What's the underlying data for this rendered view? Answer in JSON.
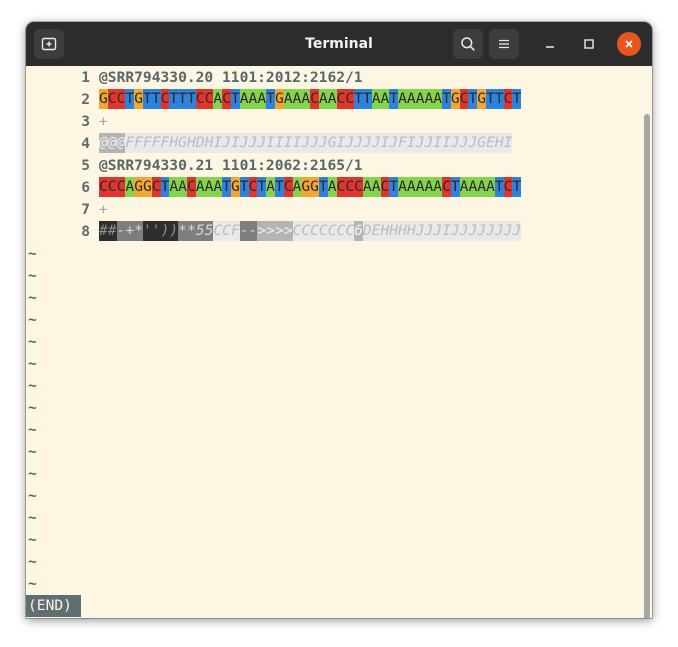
{
  "window": {
    "title": "Terminal"
  },
  "titlebar": {
    "new_tab_icon": "new-tab-icon",
    "search_icon": "search-icon",
    "menu_icon": "hamburger-icon"
  },
  "colors": {
    "A": "#86d34e",
    "C": "#e0342f",
    "G": "#f1a733",
    "T": "#2e83dd",
    "qual_dark": "#2e2e2e",
    "qual_mid": "#7e7e7e",
    "qual_light": "#b4b4b4",
    "qual_pale": "#e9e9e9"
  },
  "lines": [
    {
      "n": "1",
      "type": "header",
      "text": "@SRR794330.20 1101:2012:2162/1"
    },
    {
      "n": "2",
      "type": "seq",
      "text": "GCCTGTTCTTTCCACTAAATGAAACAACCTTAATAAAAATGCTGTTCT"
    },
    {
      "n": "3",
      "type": "plus",
      "text": "+"
    },
    {
      "n": "4",
      "type": "qual",
      "text": "@@@FFFFFHGHDHIJIJJJIIIIJJJGIJJJJIJFIJJIIJJJGEHI"
    },
    {
      "n": "5",
      "type": "header",
      "text": "@SRR794330.21 1101:2062:2165/1"
    },
    {
      "n": "6",
      "type": "seq",
      "text": "CCCAGGCTAACAAATGTCTATCAGGTACCCAACTAAAAACTAAAATCT"
    },
    {
      "n": "7",
      "type": "plus",
      "text": "+"
    },
    {
      "n": "8",
      "type": "qual",
      "text": "##-+*''))**55CCF-->>>>CCCCCCC6DEHHHHJJJIJJJJJJJJ"
    }
  ],
  "tildes": [
    "~",
    "~",
    "~",
    "~",
    "~",
    "~",
    "~",
    "~",
    "~",
    "~",
    "~",
    "~",
    "~",
    "~",
    "~",
    "~"
  ],
  "status": "(END)"
}
